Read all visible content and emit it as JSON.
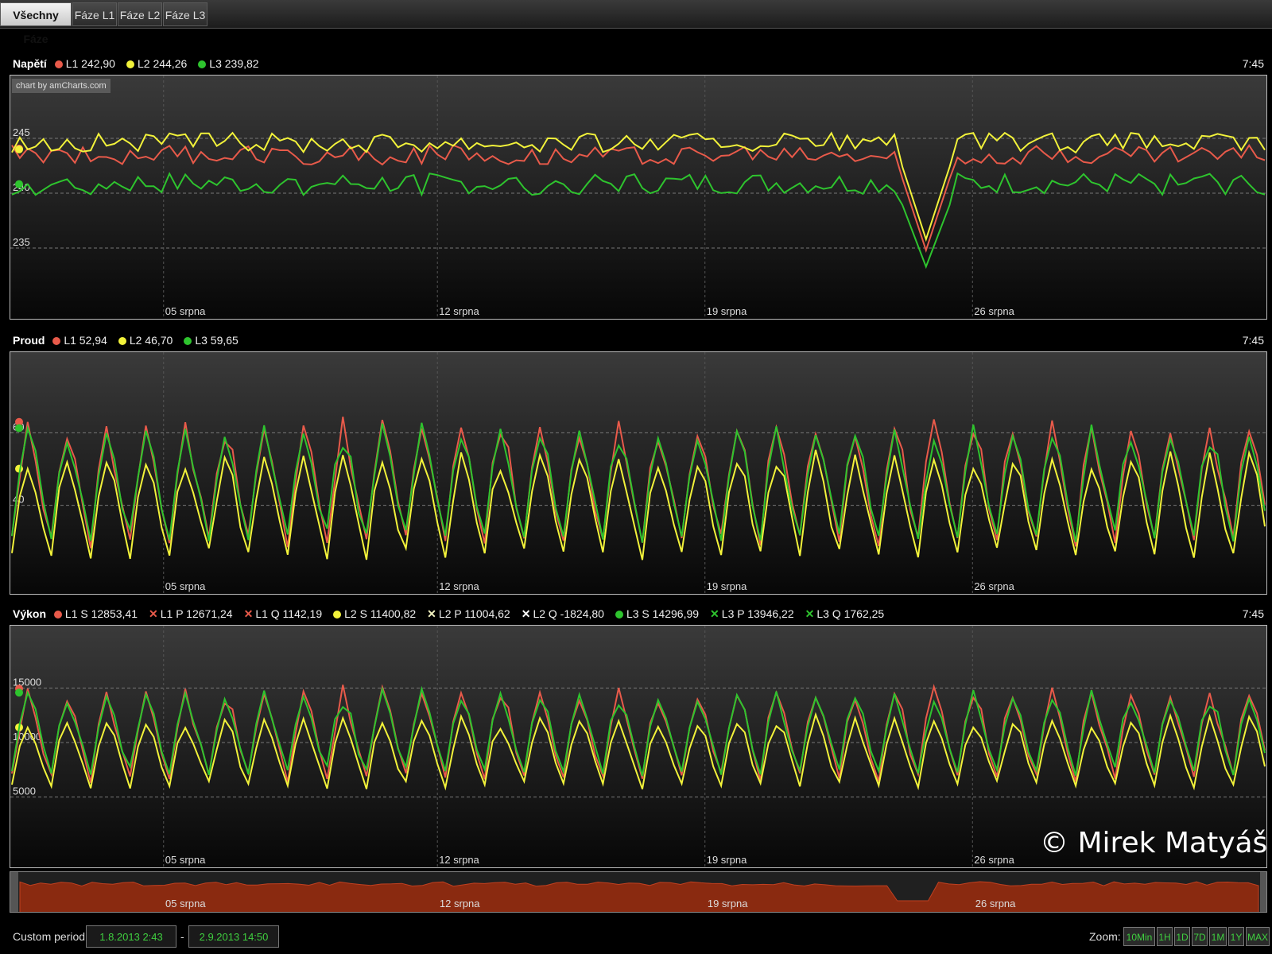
{
  "tabs": [
    {
      "label": "Všechny Fáze",
      "active": true
    },
    {
      "label": "Fáze L1",
      "active": false
    },
    {
      "label": "Fáze L2",
      "active": false
    },
    {
      "label": "Fáze L3",
      "active": false
    }
  ],
  "credit": "chart by amCharts.com",
  "watermark": "© Mirek Matyáš",
  "colors": {
    "L1": "#e85a4a",
    "L2": "#f2f23a",
    "L3": "#2ec42e",
    "L2_marker": "#f2f2c0",
    "L2Q_marker": "#ffffff",
    "navigator_fill": "#8a2a10"
  },
  "x_labels": [
    "05 srpna",
    "12 srpna",
    "19 srpna",
    "26 srpna"
  ],
  "panels": {
    "napeti": {
      "title": "Napětí",
      "time": "7:45",
      "legend": [
        {
          "label": "L1 242,90",
          "marker": "dot",
          "color": "#e85a4a"
        },
        {
          "label": "L2 244,26",
          "marker": "dot",
          "color": "#f2f23a"
        },
        {
          "label": "L3 239,82",
          "marker": "dot",
          "color": "#2ec42e"
        }
      ]
    },
    "proud": {
      "title": "Proud",
      "time": "7:45",
      "legend": [
        {
          "label": "L1 52,94",
          "marker": "dot",
          "color": "#e85a4a"
        },
        {
          "label": "L2 46,70",
          "marker": "dot",
          "color": "#f2f23a"
        },
        {
          "label": "L3 59,65",
          "marker": "dot",
          "color": "#2ec42e"
        }
      ]
    },
    "vykon": {
      "title": "Výkon",
      "time": "7:45",
      "legend": [
        {
          "label": "L1 S 12853,41",
          "marker": "dot",
          "color": "#e85a4a"
        },
        {
          "label": "L1 P 12671,24",
          "marker": "x",
          "color": "#e85a4a"
        },
        {
          "label": "L1 Q 1142,19",
          "marker": "x",
          "color": "#e85a4a"
        },
        {
          "label": "L2 S 11400,82",
          "marker": "dot",
          "color": "#f2f23a"
        },
        {
          "label": "L2 P 11004,62",
          "marker": "x",
          "color": "#f2f2c0"
        },
        {
          "label": "L2 Q -1824,80",
          "marker": "x",
          "color": "#ffffff"
        },
        {
          "label": "L3 S 14296,99",
          "marker": "dot",
          "color": "#2ec42e"
        },
        {
          "label": "L3 P 13946,22",
          "marker": "x",
          "color": "#2ec42e"
        },
        {
          "label": "L3 Q 1762,25",
          "marker": "x",
          "color": "#2ec42e"
        }
      ]
    }
  },
  "bottom": {
    "custom_period_label": "Custom period:",
    "from": "1.8.2013 2:43",
    "separator": "-",
    "to": "2.9.2013 14:50",
    "zoom_label": "Zoom:",
    "zoom_buttons": [
      "10Min",
      "1H",
      "1D",
      "7D",
      "1M",
      "1Y",
      "MAX"
    ]
  },
  "chart_data": [
    {
      "type": "line",
      "title": "Napětí",
      "x_range": [
        "1.8.2013 2:43",
        "2.9.2013 14:50"
      ],
      "ylim": [
        230,
        250
      ],
      "y_ticks": [
        235,
        240,
        245
      ],
      "grid": true,
      "series": [
        {
          "name": "L1",
          "color": "#e85a4a",
          "pattern": "oscillating",
          "base": 243.5,
          "amp": 0.9,
          "dip": {
            "at_fraction": 0.725,
            "min": 234.8
          }
        },
        {
          "name": "L2",
          "color": "#f2f23a",
          "pattern": "oscillating",
          "base": 244.6,
          "amp": 0.9,
          "dip": {
            "at_fraction": 0.725,
            "min": 235.8
          }
        },
        {
          "name": "L3",
          "color": "#2ec42e",
          "pattern": "oscillating",
          "base": 240.8,
          "amp": 1.0,
          "dip": {
            "at_fraction": 0.725,
            "min": 233.3
          }
        }
      ]
    },
    {
      "type": "line",
      "title": "Proud",
      "x_range": [
        "1.8.2013 2:43",
        "2.9.2013 14:50"
      ],
      "ylim": [
        20,
        80
      ],
      "y_ticks": [
        40,
        60
      ],
      "grid": true,
      "series": [
        {
          "name": "L1",
          "color": "#e85a4a",
          "pattern": "daily",
          "low": 27,
          "high": 64
        },
        {
          "name": "L2",
          "color": "#f2f23a",
          "pattern": "daily",
          "low": 24,
          "high": 55
        },
        {
          "name": "L3",
          "color": "#2ec42e",
          "pattern": "daily",
          "low": 28,
          "high": 63
        }
      ]
    },
    {
      "type": "line",
      "title": "Výkon",
      "x_range": [
        "1.8.2013 2:43",
        "2.9.2013 14:50"
      ],
      "ylim": [
        0,
        20000
      ],
      "y_ticks": [
        5000,
        10000,
        15000
      ],
      "grid": true,
      "series": [
        {
          "name": "L1 S",
          "color": "#e85a4a",
          "pattern": "daily",
          "low": 6000,
          "high": 15200
        },
        {
          "name": "L2 S",
          "color": "#f2f23a",
          "pattern": "daily",
          "low": 5500,
          "high": 12500
        },
        {
          "name": "L3 S",
          "color": "#2ec42e",
          "pattern": "daily",
          "low": 6500,
          "high": 15000
        }
      ]
    }
  ]
}
